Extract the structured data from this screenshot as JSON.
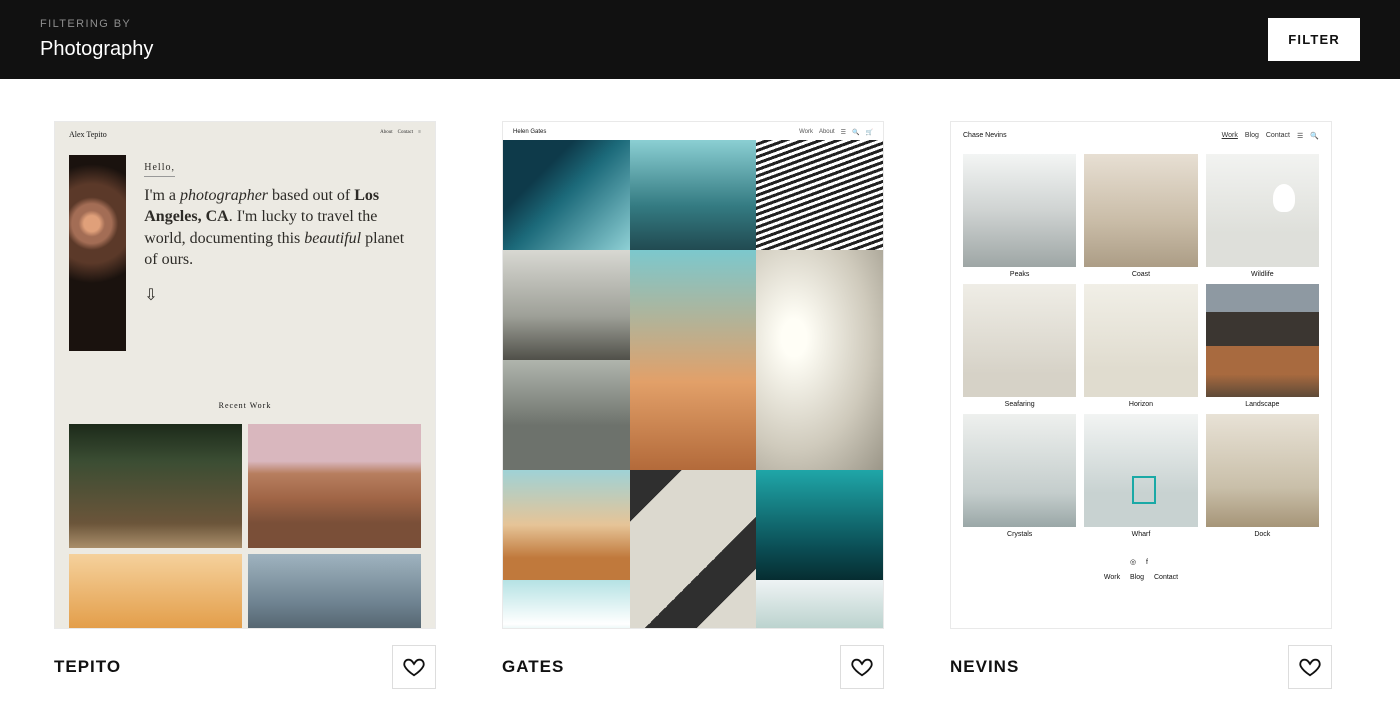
{
  "header": {
    "filtering_label": "FILTERING BY",
    "category": "Photography",
    "filter_button": "FILTER"
  },
  "templates": [
    {
      "id": "tepito",
      "name": "TEPITO",
      "preview": {
        "brand": "Alex Tepito",
        "nav": [
          "About",
          "Contact",
          "≡"
        ],
        "hello": "Hello,",
        "intro_html": "I'm a <em>photographer</em> based out of <strong>Los Angeles, CA</strong>. I'm lucky to travel the world, documenting this <em>beautiful</em> planet of ours.",
        "arrow": "⇩",
        "recent": "Recent Work"
      }
    },
    {
      "id": "gates",
      "name": "GATES",
      "preview": {
        "brand": "Helen Gates",
        "nav": [
          "Work",
          "About",
          "☰",
          "🔍",
          "🛒"
        ]
      }
    },
    {
      "id": "nevins",
      "name": "NEVINS",
      "preview": {
        "brand": "Chase Nevins",
        "nav": [
          "Work",
          "Blog",
          "Contact",
          "☰",
          "🔍"
        ],
        "items": [
          {
            "label": "Peaks"
          },
          {
            "label": "Coast"
          },
          {
            "label": "Wildlife"
          },
          {
            "label": "Seafaring"
          },
          {
            "label": "Horizon"
          },
          {
            "label": "Landscape"
          },
          {
            "label": "Crystals"
          },
          {
            "label": "Wharf"
          },
          {
            "label": "Dock"
          }
        ],
        "footer_icons": "◎  f",
        "footer_links": [
          "Work",
          "Blog",
          "Contact"
        ]
      }
    }
  ]
}
